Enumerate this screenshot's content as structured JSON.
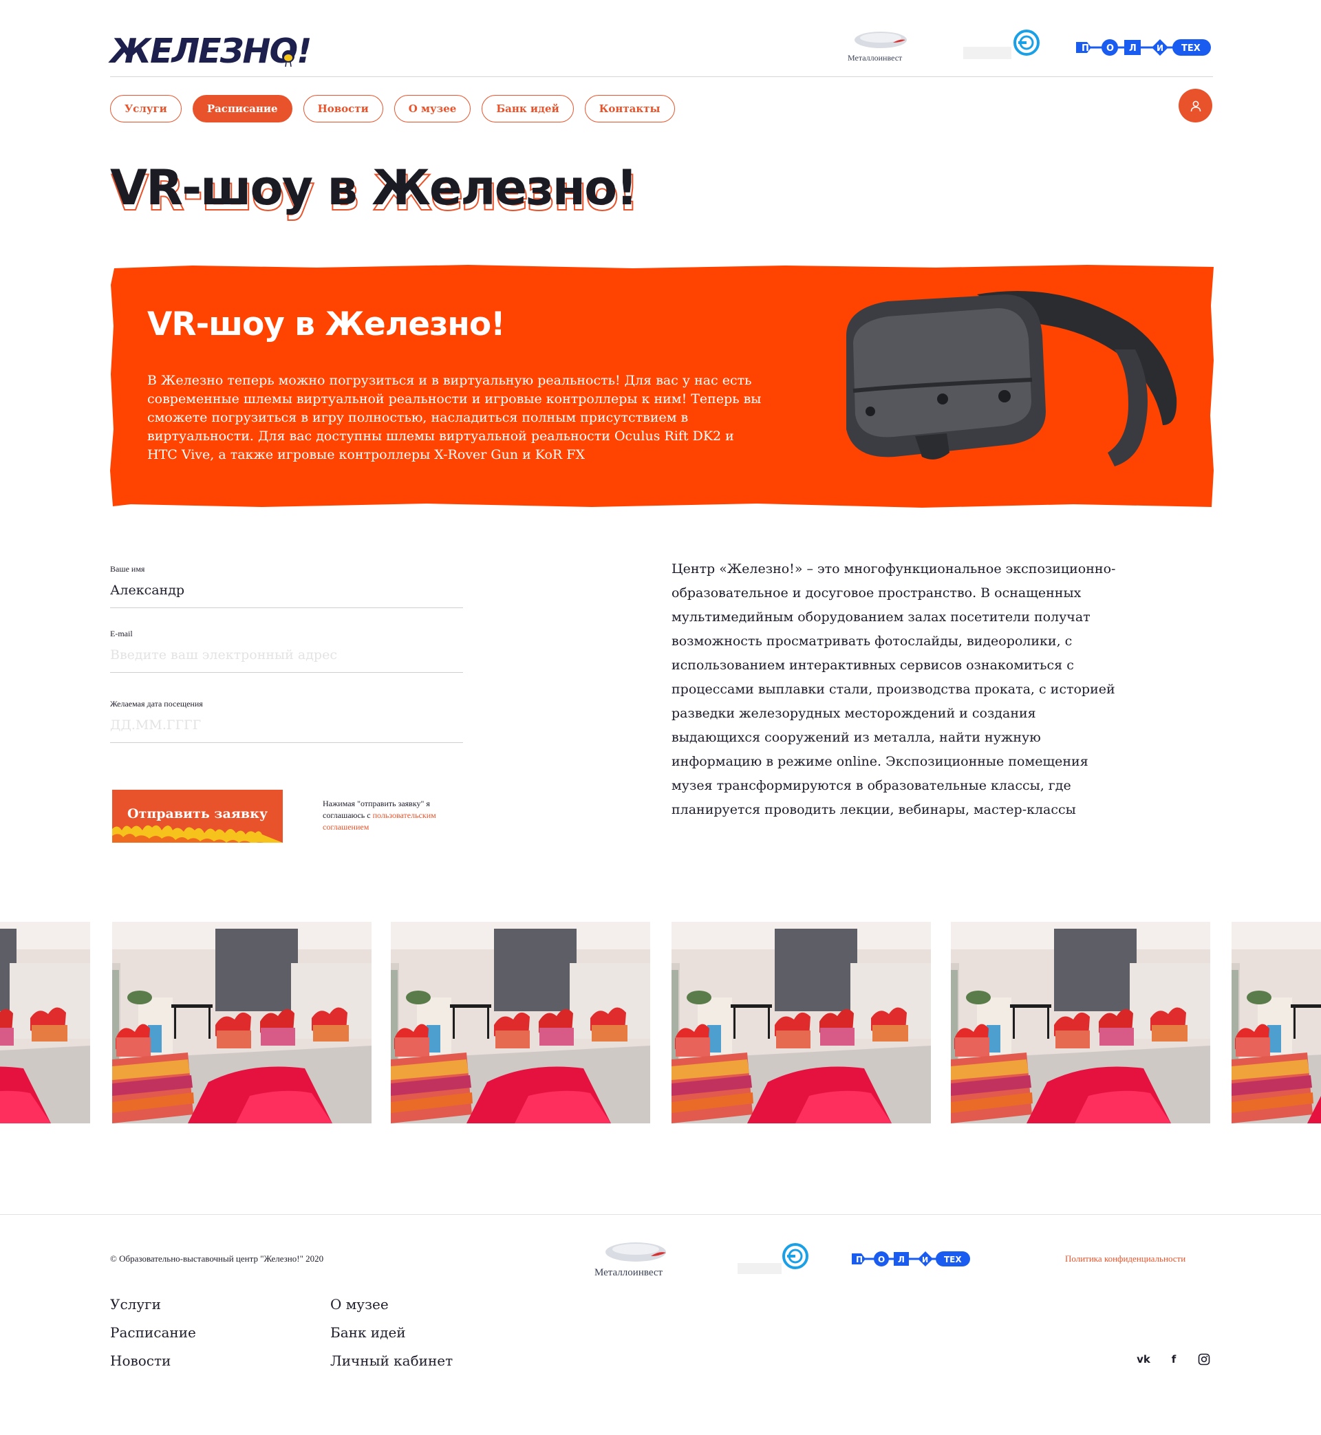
{
  "header": {
    "logo_text": "ЖЕЛЕЗНО!",
    "partners": {
      "metalloinvest": "Металлоинвест",
      "polytech_a": "П",
      "polytech_b": "О",
      "polytech_c": "Л",
      "polytech_d": "И",
      "polytech_tex": "ТЕХ"
    }
  },
  "nav": {
    "items": [
      {
        "label": "Услуги"
      },
      {
        "label": "Расписание"
      },
      {
        "label": "Новости"
      },
      {
        "label": "О музее"
      },
      {
        "label": "Банк идей"
      },
      {
        "label": "Контакты"
      }
    ],
    "active_index": 1
  },
  "page": {
    "title": "VR-шоу в Железно!"
  },
  "banner": {
    "title": "VR-шоу в Железно!",
    "text": "В Железно теперь можно погрузиться и в виртуальную реальность! Для вас у нас есть современные шлемы виртуальной реальности и игровые контроллеры к ним! Теперь вы сможете погрузиться в игру полностью, насладиться полным присутствием в виртуальности. Для вас доступны шлемы виртуальной реальности Oculus Rift DK2 и HTC Vive, а также игровые контроллеры X-Rover Gun и KoR FX"
  },
  "form": {
    "name_label": "Ваше имя",
    "name_value": "Александр",
    "email_label": "E-mail",
    "email_placeholder": "Введите ваш электронный адрес",
    "date_label": "Желаемая дата посещения",
    "date_placeholder": "ДД.ММ.ГГГГ",
    "submit_label": "Отправить заявку",
    "consent_text": "Нажимая \"отправить заявку\" я соглашаюсь с",
    "consent_link": "пользовательским соглашением"
  },
  "about": {
    "text": "Центр «Железно!» – это многофункциональное экспозиционно-образовательное и досуговое пространство. В оснащенных мультимедийным оборудованием залах посетители получат возможность просматривать фотослайды, видеоролики, с использованием интерактивных сервисов ознакомиться с процессами выплавки стали, производства проката, с историей разведки железорудных месторождений и создания выдающихся сооружений из металла, найти нужную информацию в режиме online. Экспозиционные помещения музея трансформируются в образовательные классы, где планируется проводить лекции, вебинары, мастер-классы"
  },
  "footer": {
    "copyright": "© Образовательно-выставочный центр \"Железно!\" 2020",
    "privacy": "Политика конфиденциальности",
    "links": [
      {
        "label": "Услуги"
      },
      {
        "label": "О музее"
      },
      {
        "label": "Расписание"
      },
      {
        "label": "Банк идей"
      },
      {
        "label": "Новости"
      },
      {
        "label": "Личный кабинет"
      }
    ],
    "socials": [
      {
        "icon": "vk-icon",
        "text": "vk"
      },
      {
        "icon": "facebook-icon",
        "text": "f"
      },
      {
        "icon": "instagram-icon",
        "text": ""
      }
    ]
  },
  "colors": {
    "accent": "#e8532b",
    "banner": "#ff4300",
    "logo": "#1d1f4d",
    "polytech": "#1a5cf0"
  }
}
